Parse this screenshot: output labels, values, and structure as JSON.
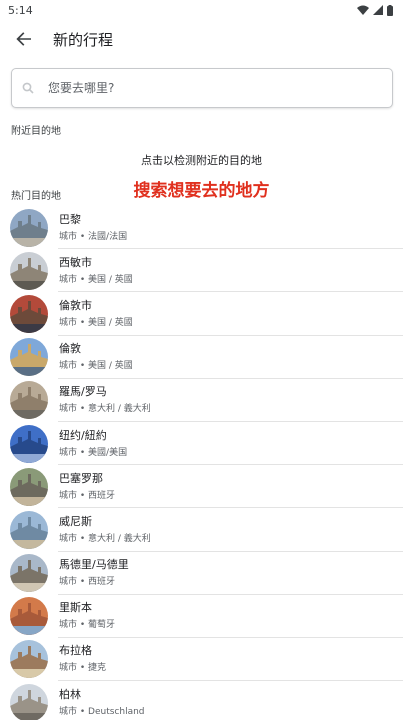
{
  "status_bar": {
    "time": "5:14"
  },
  "header": {
    "title": "新的行程"
  },
  "search": {
    "placeholder": "您要去哪里?"
  },
  "nearby": {
    "label": "附近目的地",
    "detect_text": "点击以检测附近的目的地"
  },
  "overlay_caption": "搜索想要去的地方",
  "popular": {
    "label": "热门目的地",
    "items": [
      {
        "name": "巴黎",
        "subtitle": "城市 • 法國/法国",
        "thumb_colors": [
          "#8fa7c4",
          "#6f7f8c",
          "#b8b3a7"
        ]
      },
      {
        "name": "西敏市",
        "subtitle": "城市 • 美国 / 英國",
        "thumb_colors": [
          "#c9ced4",
          "#8e8577",
          "#5d5a52"
        ]
      },
      {
        "name": "倫敦市",
        "subtitle": "城市 • 美国 / 英國",
        "thumb_colors": [
          "#b34a3a",
          "#6d4a3a",
          "#3b3a45"
        ]
      },
      {
        "name": "倫敦",
        "subtitle": "城市 • 美国 / 英國",
        "thumb_colors": [
          "#7fa8d9",
          "#c9a86a",
          "#5a6f85"
        ]
      },
      {
        "name": "羅馬/罗马",
        "subtitle": "城市 • 意大利 / 義大利",
        "thumb_colors": [
          "#b8aa96",
          "#8f7f6b",
          "#6e6a62"
        ]
      },
      {
        "name": "纽约/紐約",
        "subtitle": "城市 • 美國/美国",
        "thumb_colors": [
          "#3f6fc7",
          "#274a8c",
          "#90a9d6"
        ]
      },
      {
        "name": "巴塞罗那",
        "subtitle": "城市 • 西班牙",
        "thumb_colors": [
          "#8a9a78",
          "#6d6a5e",
          "#c2b49a"
        ]
      },
      {
        "name": "威尼斯",
        "subtitle": "城市 • 意大利 / 義大利",
        "thumb_colors": [
          "#9bb8d6",
          "#6f8aa3",
          "#c4b89e"
        ]
      },
      {
        "name": "馬德里/马德里",
        "subtitle": "城市 • 西班牙",
        "thumb_colors": [
          "#a9b8c9",
          "#7b7468",
          "#d0c6b3"
        ]
      },
      {
        "name": "里斯本",
        "subtitle": "城市 • 葡萄牙",
        "thumb_colors": [
          "#d37a4a",
          "#a85a3a",
          "#87a6c6"
        ]
      },
      {
        "name": "布拉格",
        "subtitle": "城市 • 捷克",
        "thumb_colors": [
          "#a7c2dc",
          "#9c7b5e",
          "#d8c9a8"
        ]
      },
      {
        "name": "柏林",
        "subtitle": "城市 • Deutschland",
        "thumb_colors": [
          "#cfd6de",
          "#9a9388",
          "#6f6a62"
        ]
      }
    ]
  }
}
